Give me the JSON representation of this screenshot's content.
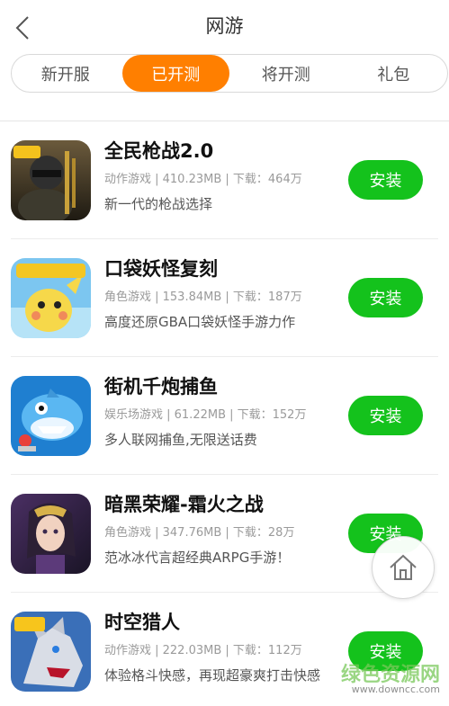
{
  "header": {
    "title": "网游",
    "back_icon": "chevron-left-icon"
  },
  "tabs": [
    {
      "label": "新开服",
      "active": false
    },
    {
      "label": "已开测",
      "active": true
    },
    {
      "label": "将开测",
      "active": false
    },
    {
      "label": "礼包",
      "active": false
    }
  ],
  "accent_color": "#ff7f00",
  "install_color": "#14c21c",
  "apps": [
    {
      "name": "全民枪战2.0",
      "meta": "动作游戏 | 410.23MB | 下载：464万",
      "desc": "新一代的枪战选择",
      "install_label": "安装",
      "icon": "soldier-game-icon"
    },
    {
      "name": "口袋妖怪复刻",
      "meta": "角色游戏 | 153.84MB | 下载：187万",
      "desc": "高度还原GBA口袋妖怪手游力作",
      "install_label": "安装",
      "icon": "pocket-monster-game-icon"
    },
    {
      "name": "街机千炮捕鱼",
      "meta": "娱乐场游戏 | 61.22MB | 下载：152万",
      "desc": "多人联网捕鱼,无限送话费",
      "install_label": "安装",
      "icon": "shark-game-icon"
    },
    {
      "name": "暗黑荣耀-霜火之战",
      "meta": "角色游戏 | 347.76MB | 下载：28万",
      "desc": "范冰冰代言超经典ARPG手游！",
      "install_label": "安装",
      "icon": "heroine-game-icon"
    },
    {
      "name": "时空猎人",
      "meta": "动作游戏 | 222.03MB | 下载：112万",
      "desc": "体验格斗快感，再现超豪爽打击快感",
      "install_label": "安装",
      "icon": "wolf-game-icon"
    }
  ],
  "home_button": {
    "icon": "home-icon"
  },
  "watermark": {
    "main": "绿色资源网",
    "sub": "www.downcc.com"
  }
}
